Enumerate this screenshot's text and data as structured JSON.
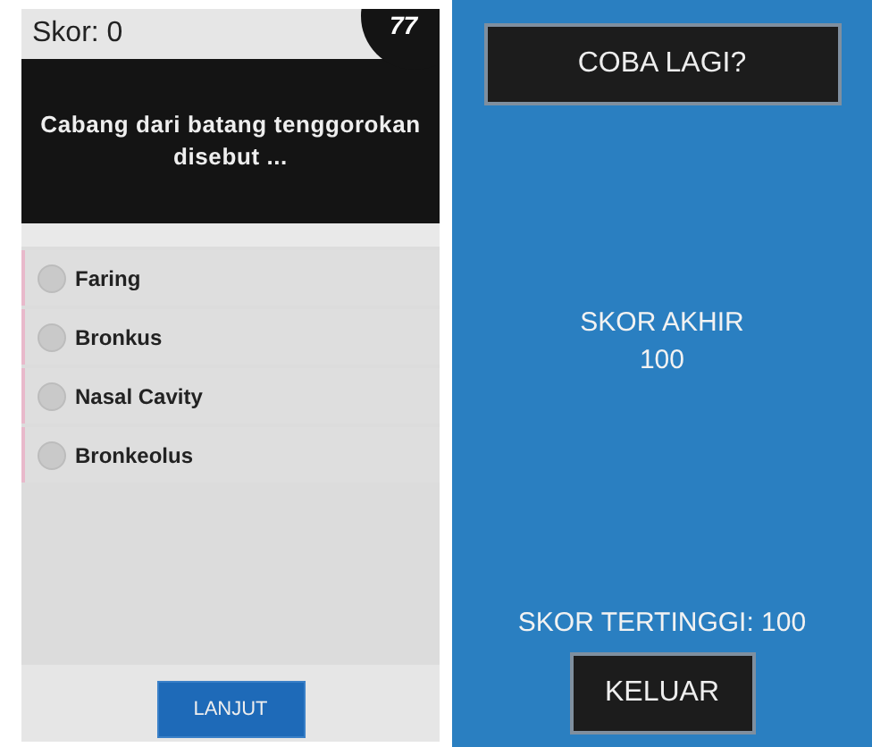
{
  "quiz_screen": {
    "score": "Skor: 0",
    "timer": "77",
    "question": "Cabang dari batang tenggorokan disebut ...",
    "options": [
      {
        "label": "Faring",
        "selected": false
      },
      {
        "label": "Bronkus",
        "selected": false
      },
      {
        "label": "Nasal Cavity",
        "selected": false
      },
      {
        "label": "Bronkeolus",
        "selected": false
      }
    ],
    "next_button": "LANJUT"
  },
  "result_screen": {
    "retry_button": "COBA LAGI?",
    "final_score_label": "SKOR AKHIR",
    "final_score": "100",
    "high_score": "SKOR TERTINGGI: 100",
    "exit_button": "KELUAR"
  }
}
